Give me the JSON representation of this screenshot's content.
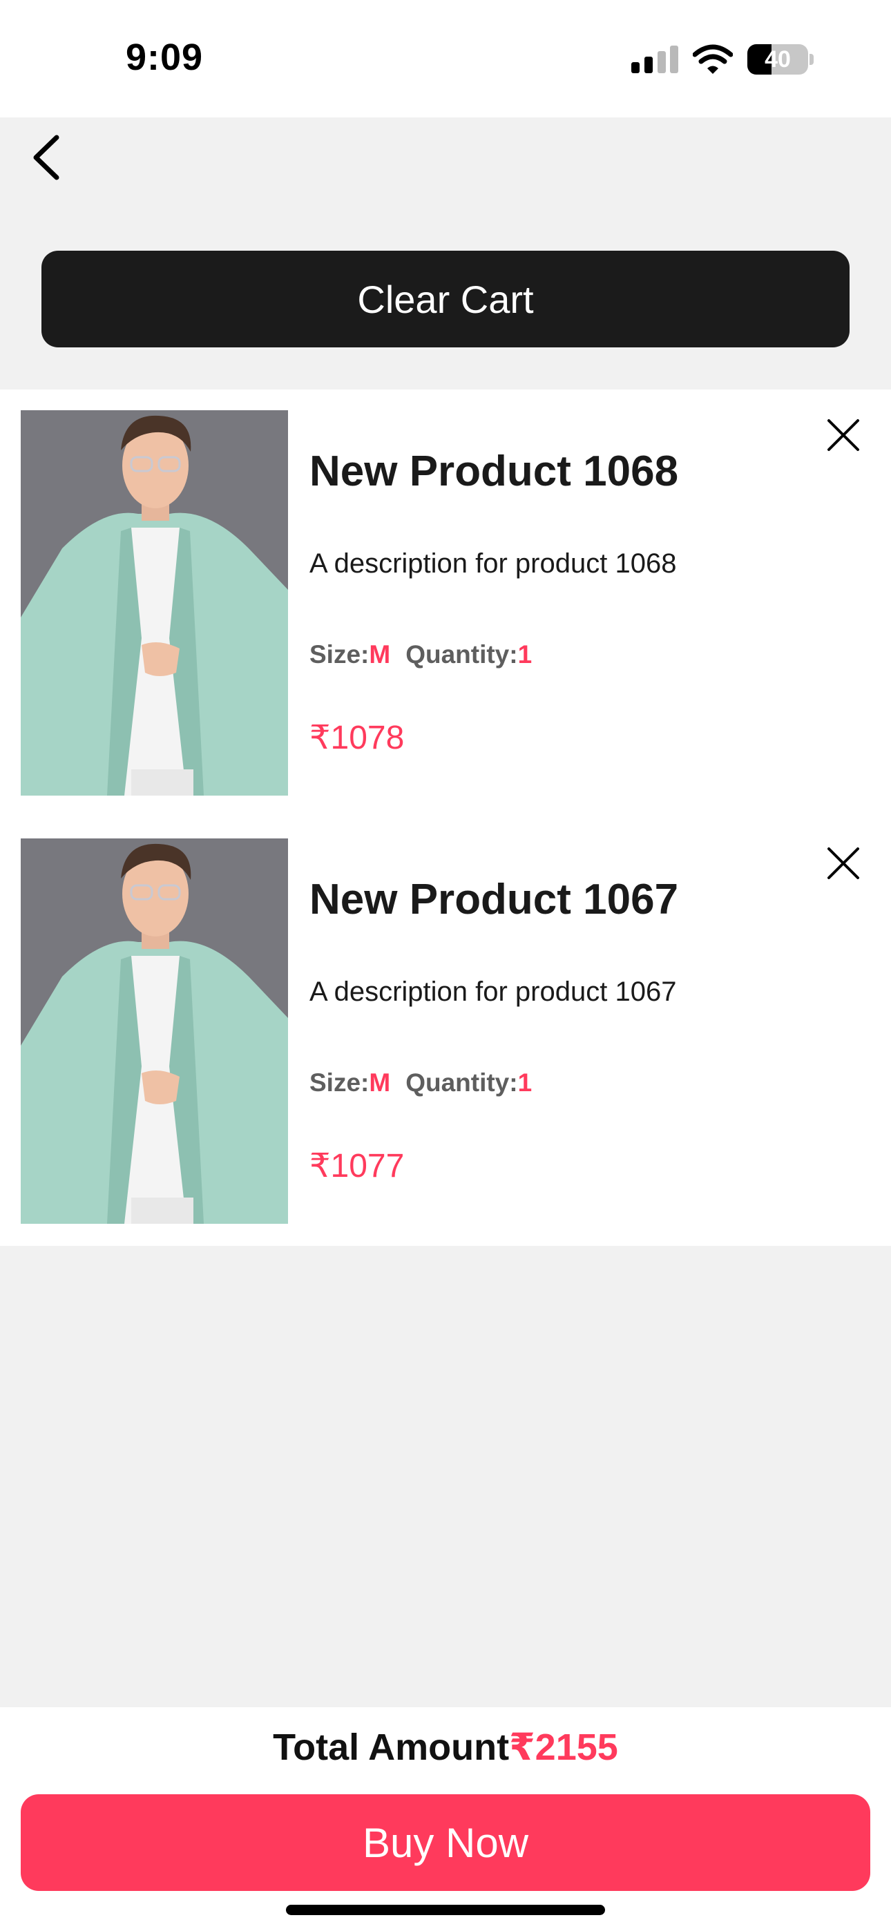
{
  "status_bar": {
    "time": "9:09",
    "battery_level": "40",
    "battery_fraction": 0.4,
    "icons": [
      "cellular-signal-icon",
      "wifi-icon",
      "battery-icon"
    ]
  },
  "nav": {
    "back_icon": "chevron-left-icon"
  },
  "clear_cart_label": "Clear Cart",
  "cart": {
    "items": [
      {
        "title": "New Product 1068",
        "description": "A description for product 1068",
        "size_label": "Size:",
        "size": "M",
        "quantity_label": "Quantity:",
        "quantity": "1",
        "price": "₹1078",
        "remove_icon": "close-icon"
      },
      {
        "title": "New Product 1067",
        "description": "A description for product 1067",
        "size_label": "Size:",
        "size": "M",
        "quantity_label": "Quantity:",
        "quantity": "1",
        "price": "₹1077",
        "remove_icon": "close-icon"
      }
    ]
  },
  "footer": {
    "total_label": "Total Amount",
    "total_amount": "₹2155",
    "buy_now_label": "Buy Now"
  },
  "colors": {
    "accent": "#ff3a5c",
    "dark_button": "#1b1b1b",
    "page_background": "#f1f1f1"
  }
}
